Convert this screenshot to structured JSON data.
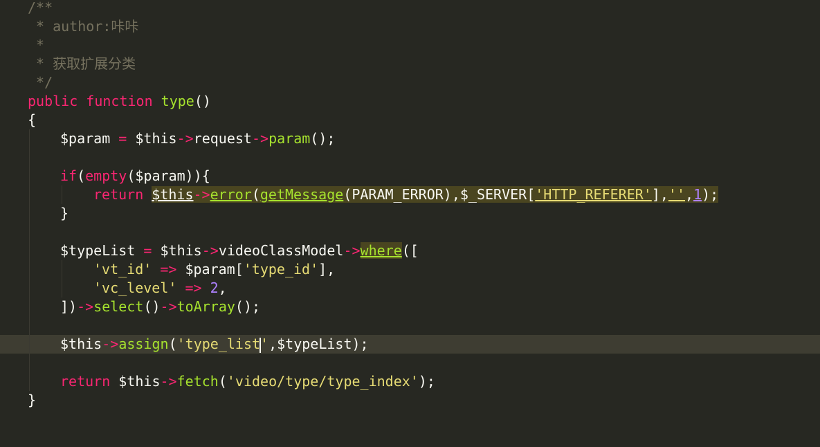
{
  "editor": {
    "comment": {
      "open": "/**",
      "author": " * author:咔咔",
      "blank": " *",
      "desc": " * 获取扩展分类",
      "close": " */"
    },
    "signature": {
      "public": "public",
      "function": "function",
      "name": "type",
      "parens": "()"
    },
    "brace_open": "{",
    "brace_close": "}",
    "line_param": {
      "var": "$param",
      "eq": " = ",
      "this": "$this",
      "arrow1": "->",
      "request": "request",
      "arrow2": "->",
      "method": "param",
      "end": "();"
    },
    "line_if": {
      "kw": "if",
      "p1": "(",
      "fn": "empty",
      "arg": "($param)){"
    },
    "line_return_error": {
      "kw": "return",
      "this": "$this",
      "arrow": "->",
      "fn": "error",
      "p1": "(",
      "fn2": "getMessage",
      "arg1": "(PARAM_ERROR),",
      "server": "$_SERVER",
      "b1": "[",
      "key": "'HTTP_REFERER'",
      "b2": "],",
      "empty": "''",
      "comma": ",",
      "num": "1",
      "end": ");"
    },
    "line_close_if": "}",
    "line_typelist": {
      "var": "$typeList",
      "eq": " = ",
      "this": "$this",
      "arrow1": "->",
      "model": "videoClassModel",
      "arrow2": "->",
      "fn": "where",
      "end": "(["
    },
    "line_vt": {
      "key": "'vt_id'",
      "op": " => ",
      "var": "$param",
      "b1": "[",
      "str": "'type_id'",
      "end": "],",
      "extra": ""
    },
    "line_vc": {
      "key": "'vc_level'",
      "op": " => ",
      "num": "2",
      "end": ","
    },
    "line_select": {
      "start": "])",
      "a1": "->",
      "fn1": "select",
      "p": "()",
      "a2": "->",
      "fn2": "toArray",
      "end": "();"
    },
    "line_assign": {
      "this": "$this",
      "arrow": "->",
      "fn": "assign",
      "p1": "(",
      "str_a": "'type_list",
      "str_b": "'",
      "rest": ",$typeList);"
    },
    "line_fetch": {
      "kw": "return",
      "sp": " ",
      "this": "$this",
      "arrow": "->",
      "fn": "fetch",
      "p1": "(",
      "str": "'video/type/type_index'",
      "end": ");"
    }
  },
  "colors": {
    "background": "#272822",
    "comment": "#75715e",
    "keyword": "#f92672",
    "function": "#a6e22e",
    "string": "#e6db74",
    "number": "#ae81ff",
    "text": "#f8f8f2",
    "current_line": "#3e3d32"
  }
}
